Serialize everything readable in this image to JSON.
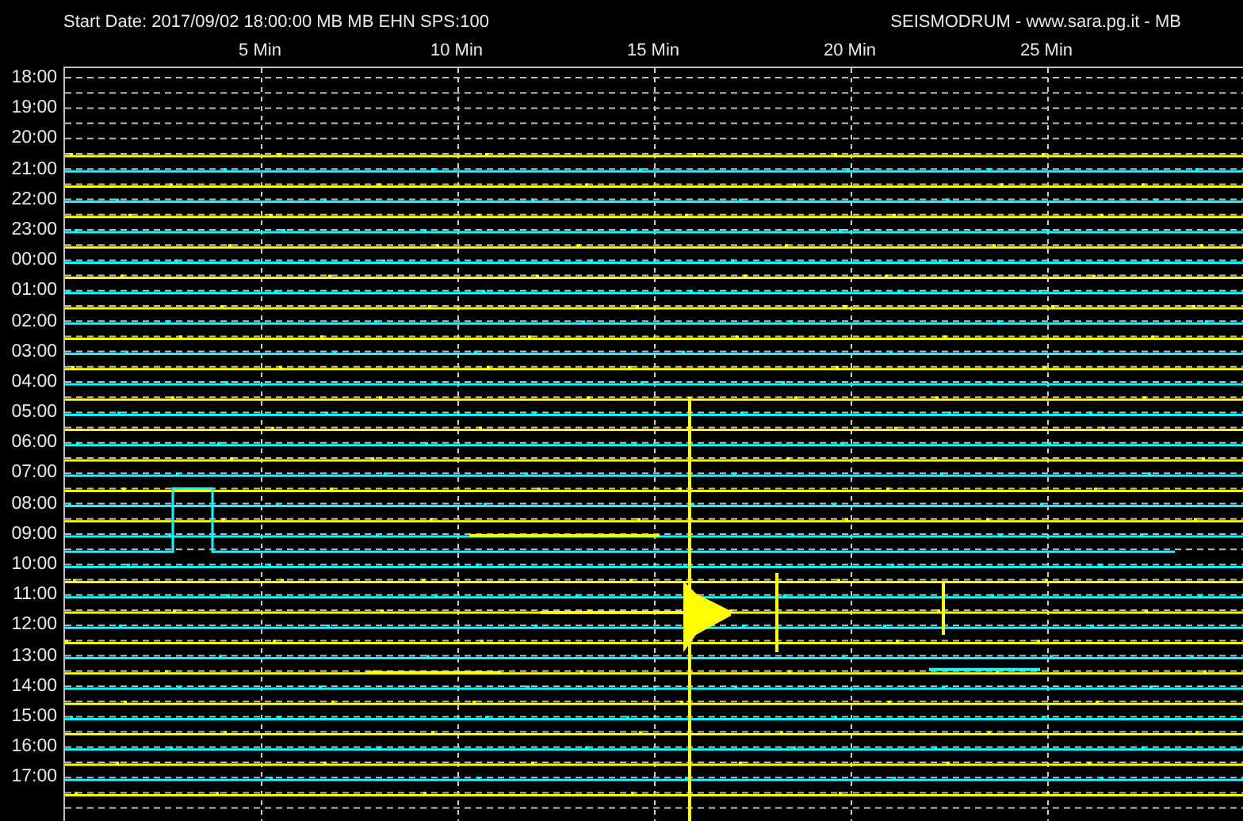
{
  "header": {
    "title": "Start Date: 2017/09/02 18:00:00 MB MB EHN SPS:100",
    "source": "SEISMODRUM - www.sara.pg.it - MB"
  },
  "x_axis": {
    "labels": [
      "5 Min",
      "10 Min",
      "15 Min",
      "20 Min",
      "25 Min"
    ]
  },
  "hours": [
    "18:00",
    "19:00",
    "20:00",
    "21:00",
    "22:00",
    "23:00",
    "00:00",
    "01:00",
    "02:00",
    "03:00",
    "04:00",
    "05:00",
    "06:00",
    "07:00",
    "08:00",
    "09:00",
    "10:00",
    "11:00",
    "12:00",
    "13:00",
    "14:00",
    "15:00",
    "16:00",
    "17:00"
  ]
}
